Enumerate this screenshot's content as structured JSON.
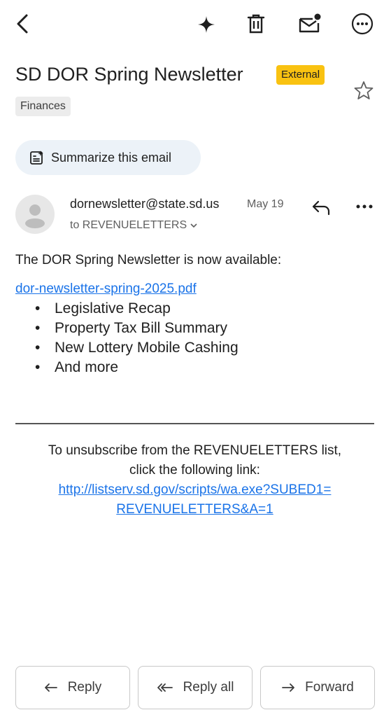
{
  "toolbar": {
    "icons": [
      "back-icon",
      "sparkle-icon",
      "trash-icon",
      "mark-unread-icon",
      "more-options-icon"
    ]
  },
  "email": {
    "subject": "SD DOR Spring Newsletter",
    "external_badge": "External",
    "label": "Finances",
    "summarize_label": "Summarize this email",
    "sender": "dornewsletter@state.sd.us",
    "date": "May 19",
    "recipient": "to REVENUELETTERS",
    "body": {
      "intro": "The DOR Spring Newsletter is now available:",
      "attachment_link": "dor-newsletter-spring-2025.pdf",
      "bullets": [
        "Legislative Recap",
        "Property Tax Bill Summary",
        "New Lottery Mobile Cashing",
        "And more"
      ],
      "unsubscribe_text_1": "To unsubscribe from the REVENUELETTERS list,",
      "unsubscribe_text_2": "click the following link:",
      "unsubscribe_link_1": "http://listserv.sd.gov/scripts/wa.exe?SUBED1=",
      "unsubscribe_link_2": "REVENUELETTERS&A=1"
    }
  },
  "actions": {
    "reply": "Reply",
    "reply_all": "Reply all",
    "forward": "Forward"
  },
  "colors": {
    "badge": "#f9c211",
    "link": "#1a73e8",
    "summarize_bg": "#ecf2f8"
  }
}
